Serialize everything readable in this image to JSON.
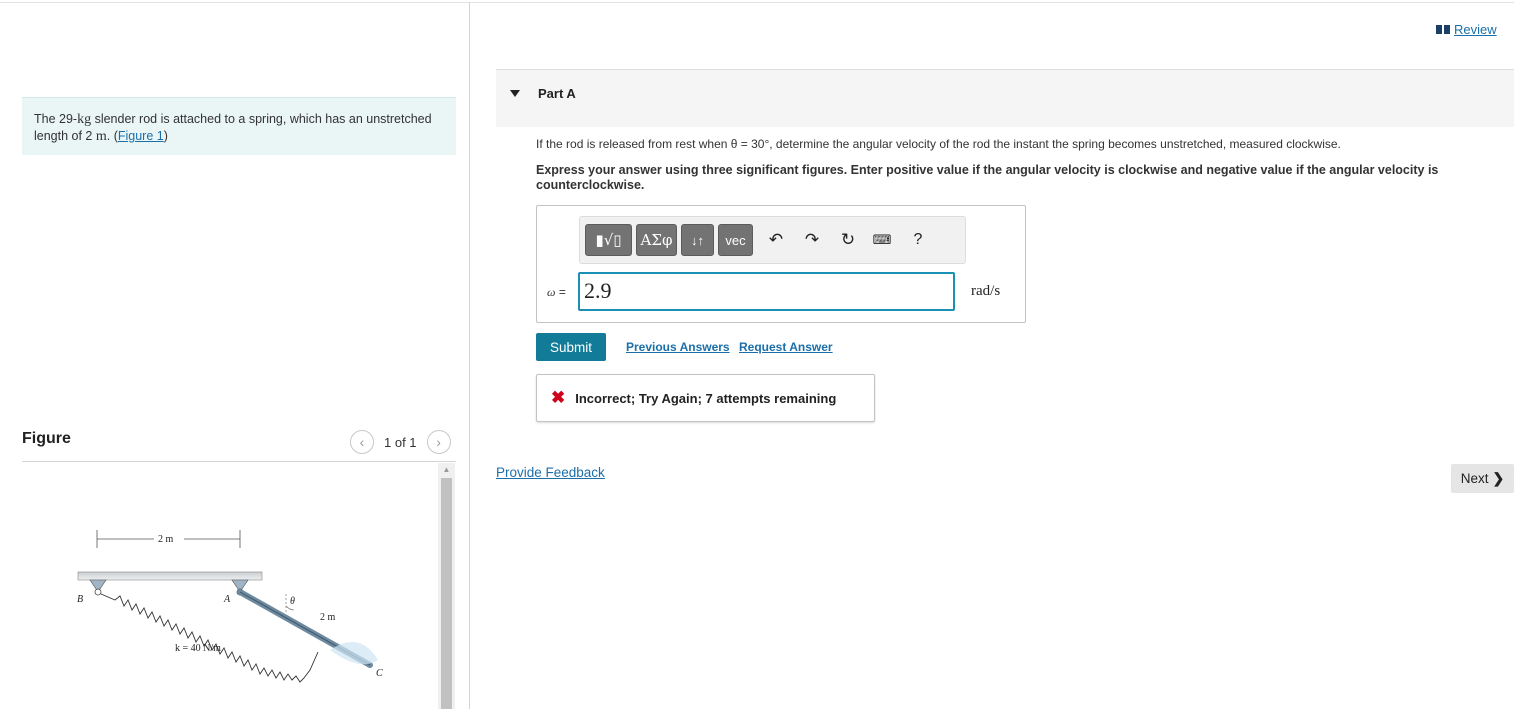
{
  "problem": {
    "text_before_mass": "The 29-",
    "mass_unit": "kg",
    "text_middle": " slender rod is attached to a spring, which has an unstretched length of 2 ",
    "length_unit": "m",
    "text_after": ". (",
    "figure_link": "Figure 1",
    "text_close": ")"
  },
  "figure": {
    "title": "Figure",
    "pager": "1 of 1",
    "prev_icon": "chevron-left",
    "next_icon": "chevron-right",
    "labels": {
      "top_dim": "2 m",
      "point_b": "B",
      "point_a": "A",
      "angle": "θ",
      "rod_len": "2 m",
      "spring": "k = 40 N/m",
      "point_c": "C"
    }
  },
  "review": {
    "label": "Review"
  },
  "part": {
    "title": "Part A",
    "question": "If the rod is released from rest when θ = 30°, determine the angular velocity of the rod the instant the spring becomes unstretched, measured clockwise.",
    "instruction": "Express your answer using three significant figures. Enter positive value if the angular velocity is clockwise and negative value if the angular velocity is counterclockwise."
  },
  "toolbar": {
    "templates_label": "▮√▯",
    "greek_label": "ΑΣφ",
    "arrows_label": "↓↑",
    "vec_label": "vec",
    "help_label": "?"
  },
  "answer": {
    "var_label": "ω",
    "eq": " =",
    "value": "2.9",
    "units": "rad/s"
  },
  "actions": {
    "submit": "Submit",
    "previous_answers": "Previous Answers",
    "request_answer": "Request Answer"
  },
  "result": {
    "text": "Incorrect; Try Again; 7 attempts remaining",
    "color": "#d0021b"
  },
  "footer": {
    "provide_feedback": "Provide Feedback",
    "next": "Next"
  },
  "colors": {
    "accent": "#127c98",
    "link": "#1b6fa8",
    "input_border": "#1b90b5",
    "problem_bg": "#eaf5f6"
  }
}
